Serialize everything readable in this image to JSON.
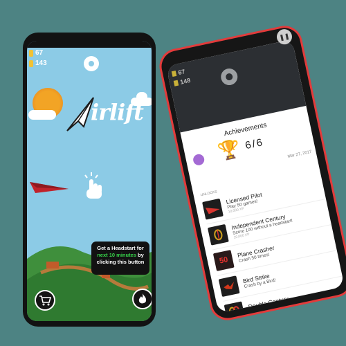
{
  "left_phone": {
    "hud": {
      "trophies": "67",
      "coins": "143"
    },
    "logo_text": "irlift",
    "tooltip": {
      "line1": "Get a Headstart for",
      "highlight": "next 10 minutes",
      "line2": "by",
      "line3": "clicking this button"
    },
    "colors": {
      "sky": "#8ccbe6",
      "sun": "#f2a425",
      "plane": "#c0232b",
      "hills": "#3f8f3c",
      "highlight": "#37d44a"
    }
  },
  "right_phone": {
    "hud": {
      "trophies": "67",
      "coins": "148"
    },
    "title": "Achievements",
    "count": "6/6",
    "date": "Mar 27, 2017",
    "unlocks_label": "UNLOCKS",
    "achievements": [
      {
        "name": "Licensed Pilot",
        "desc": "Play 50 games!",
        "xp": "10,000 XP",
        "icon": "red-plane-icon",
        "accent": "#d8352f"
      },
      {
        "name": "Independent Century",
        "desc": "Score 100 without a headstart!",
        "xp": "10,000 XP",
        "icon": "ring-icon",
        "accent": "#d0a11e"
      },
      {
        "name": "Plane Crasher",
        "desc": "Crash 50 times!",
        "xp": "",
        "icon": "fifty-icon",
        "accent": "#e8322d"
      },
      {
        "name": "Bird Strike",
        "desc": "Crash by a Bird!",
        "xp": "",
        "icon": "bird-icon",
        "accent": "#d2371b"
      },
      {
        "name": "Double Century",
        "desc": "Pass throu",
        "xp": "",
        "icon": "double-ring-icon",
        "accent": "#d0a11e"
      }
    ]
  }
}
